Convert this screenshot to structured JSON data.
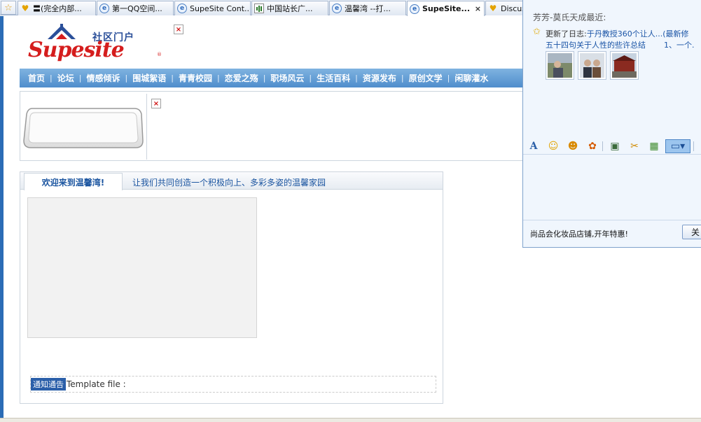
{
  "browser": {
    "tabs": [
      {
        "label": "〓(完全内部...",
        "icon": "chat-bubble-icon",
        "active": false
      },
      {
        "label": "第一QQ空间...",
        "icon": "ie-page-icon",
        "active": false
      },
      {
        "label": "SupeSite Cont...",
        "icon": "ie-page-icon",
        "active": false
      },
      {
        "label": "中国站长广...",
        "icon": "chart-icon",
        "active": false
      },
      {
        "label": "温馨湾 --打...",
        "icon": "ie-page-icon",
        "active": false
      },
      {
        "label": "SupeSite...",
        "icon": "ie-page-icon",
        "active": true
      },
      {
        "label": "Discuz",
        "icon": "chat-bubble-icon",
        "active": false
      }
    ],
    "close_glyph": "×",
    "star_glyph": "☆"
  },
  "site": {
    "logo_cn": "社区门户",
    "logo_brand": "Supesite",
    "logo_mark": "®",
    "broken_image_glyph": "×"
  },
  "nav": {
    "items": [
      "首页",
      "论坛",
      "情感倾诉",
      "围城絮语",
      "青青校园",
      "恋爱之殇",
      "职场风云",
      "生活百科",
      "资源发布",
      "原创文学",
      "闲聊灌水"
    ],
    "separator": "|"
  },
  "panel": {
    "tab_label": "欢迎来到温馨湾!",
    "slogan": "让我们共同创造一个积极向上、多彩多姿的温馨家园",
    "notice_badge": "通知通告",
    "notice_text": "Template file :"
  },
  "qq_popup": {
    "title": "芳芳-莫氏天成最近:",
    "update_prefix": "更新了日志:",
    "update_link": "于丹教授360个让人...(最新修",
    "line2_a": "五十四句关于人性的些许总结",
    "line2_b": "1、一个.",
    "toolbar_icons": [
      "font-icon",
      "smiley-icon",
      "emotion-icon",
      "sticker-icon",
      "image-icon",
      "scissors-icon",
      "gift-icon",
      "screen-capture-icon"
    ],
    "ad_text": "尚品会化妆品店铺,开年特惠!",
    "close_label": "关"
  },
  "colors": {
    "nav_top": "#7fb3e0",
    "nav_bottom": "#4f8dcc",
    "brand_red": "#d51d1d",
    "link_blue": "#1b55a0",
    "left_rail": "#2b6cb6"
  }
}
